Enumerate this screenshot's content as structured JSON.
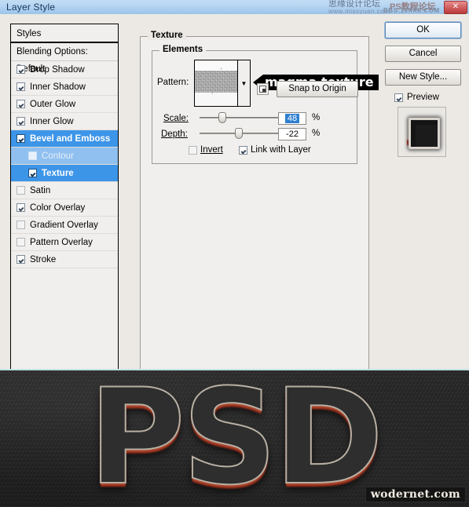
{
  "window": {
    "title": "Layer Style",
    "close_label": "✕",
    "watermark_cn": "思缘设计论坛",
    "watermark_url": "www.missyuan.com",
    "watermark_ps": "PS教程论坛",
    "watermark_bbs": "BBS.16XX8.COM"
  },
  "styles_panel": {
    "header": "Styles",
    "blending_options": "Blending Options: Default",
    "items": [
      {
        "label": "Drop Shadow",
        "checked": true,
        "selected": false,
        "indent": false,
        "dim": false
      },
      {
        "label": "Inner Shadow",
        "checked": true,
        "selected": false,
        "indent": false,
        "dim": false
      },
      {
        "label": "Outer Glow",
        "checked": true,
        "selected": false,
        "indent": false,
        "dim": false
      },
      {
        "label": "Inner Glow",
        "checked": true,
        "selected": false,
        "indent": false,
        "dim": false
      },
      {
        "label": "Bevel and Emboss",
        "checked": true,
        "selected": true,
        "indent": false,
        "dim": false
      },
      {
        "label": "Contour",
        "checked": false,
        "selected": "light",
        "indent": true,
        "dim": true
      },
      {
        "label": "Texture",
        "checked": true,
        "selected": true,
        "indent": true,
        "dim": false
      },
      {
        "label": "Satin",
        "checked": false,
        "selected": false,
        "indent": false,
        "dim": true
      },
      {
        "label": "Color Overlay",
        "checked": true,
        "selected": false,
        "indent": false,
        "dim": false
      },
      {
        "label": "Gradient Overlay",
        "checked": false,
        "selected": false,
        "indent": false,
        "dim": true
      },
      {
        "label": "Pattern Overlay",
        "checked": false,
        "selected": false,
        "indent": false,
        "dim": true
      },
      {
        "label": "Stroke",
        "checked": true,
        "selected": false,
        "indent": false,
        "dim": false
      }
    ]
  },
  "texture": {
    "group_title": "Texture",
    "elements_title": "Elements",
    "pattern_label": "Pattern:",
    "callout_text": "magma texture",
    "snap_button": "Snap to Origin",
    "scale_label": "Scale:",
    "scale_value": "48",
    "scale_unit": "%",
    "depth_label": "Depth:",
    "depth_value": "-22",
    "depth_unit": "%",
    "invert_label": "Invert",
    "invert_checked": false,
    "link_label": "Link with Layer",
    "link_checked": true
  },
  "actions": {
    "ok": "OK",
    "cancel": "Cancel",
    "new_style": "New Style...",
    "preview_label": "Preview",
    "preview_checked": true
  },
  "artwork": {
    "text": "PSD",
    "watermark": "wodernet.com"
  },
  "colors": {
    "accent_selected": "#3d95e8",
    "title_gradient_top": "#c3dcf4",
    "title_gradient_bottom": "#9cc4e8",
    "dialog_bg": "#ece9e4",
    "panel_bg": "#f1efed",
    "artwork_bg": "#232323",
    "artwork_red": "#b22e1c"
  }
}
